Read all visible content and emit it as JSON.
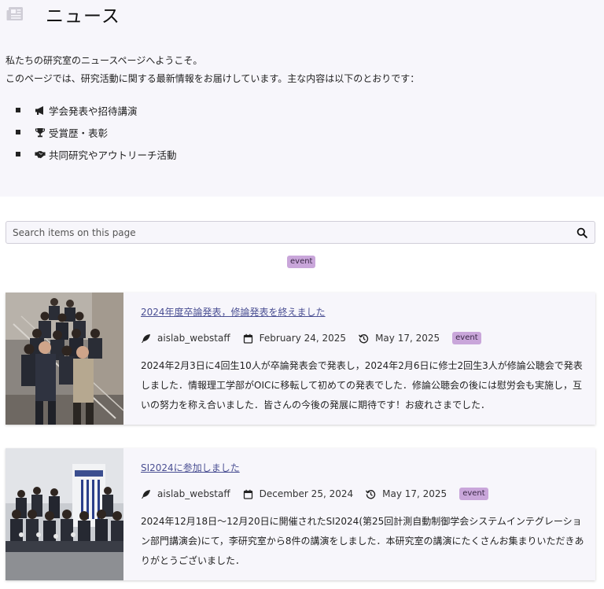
{
  "header": {
    "title": "ニュース",
    "icon": "newspaper-icon"
  },
  "intro": {
    "line1": "私たちの研究室のニュースページへようこそ。",
    "line2": "このページでは、研究活動に関する最新情報をお届けしています。主な内容は以下のとおりです："
  },
  "bullets": [
    {
      "icon": "megaphone-icon",
      "label": "学会発表や招待講演"
    },
    {
      "icon": "trophy-icon",
      "label": "受賞歴・表彰"
    },
    {
      "icon": "handshake-icon",
      "label": "共同研究やアウトリーチ活動"
    }
  ],
  "search": {
    "placeholder": "Search items on this page",
    "value": ""
  },
  "filter": {
    "tag": "event"
  },
  "colors": {
    "accent_tag": "#c9a6da",
    "link": "#4a4f93",
    "panel": "#f7f6fb"
  },
  "posts": [
    {
      "title": "2024年度卒論発表，修論発表を終えました",
      "author": "aislab_webstaff",
      "date": "February 24, 2025",
      "updated": "May 17, 2025",
      "tag": "event",
      "excerpt": "2024年2月3日に4回生10人が卒論発表会で発表し，2024年2月6日に修士2回生3人が修論公聴会で発表しました．情報理工学部がOICに移転して初めての発表でした．修論公聴会の後には慰労会も実施し，互いの努力を称え合いました．皆さんの今後の発展に期待です！お疲れさまでした．"
    },
    {
      "title": "SI2024に参加しました",
      "author": "aislab_webstaff",
      "date": "December 25, 2024",
      "updated": "May 17, 2025",
      "tag": "event",
      "excerpt": "2024年12月18日〜12月20日に開催されたSI2024(第25回計測自動制御学会システムインテグレーション部門講演会)にて，李研究室から8件の講演をしました．本研究室の講演にたくさんお集まりいただきありがとうございました．"
    }
  ]
}
